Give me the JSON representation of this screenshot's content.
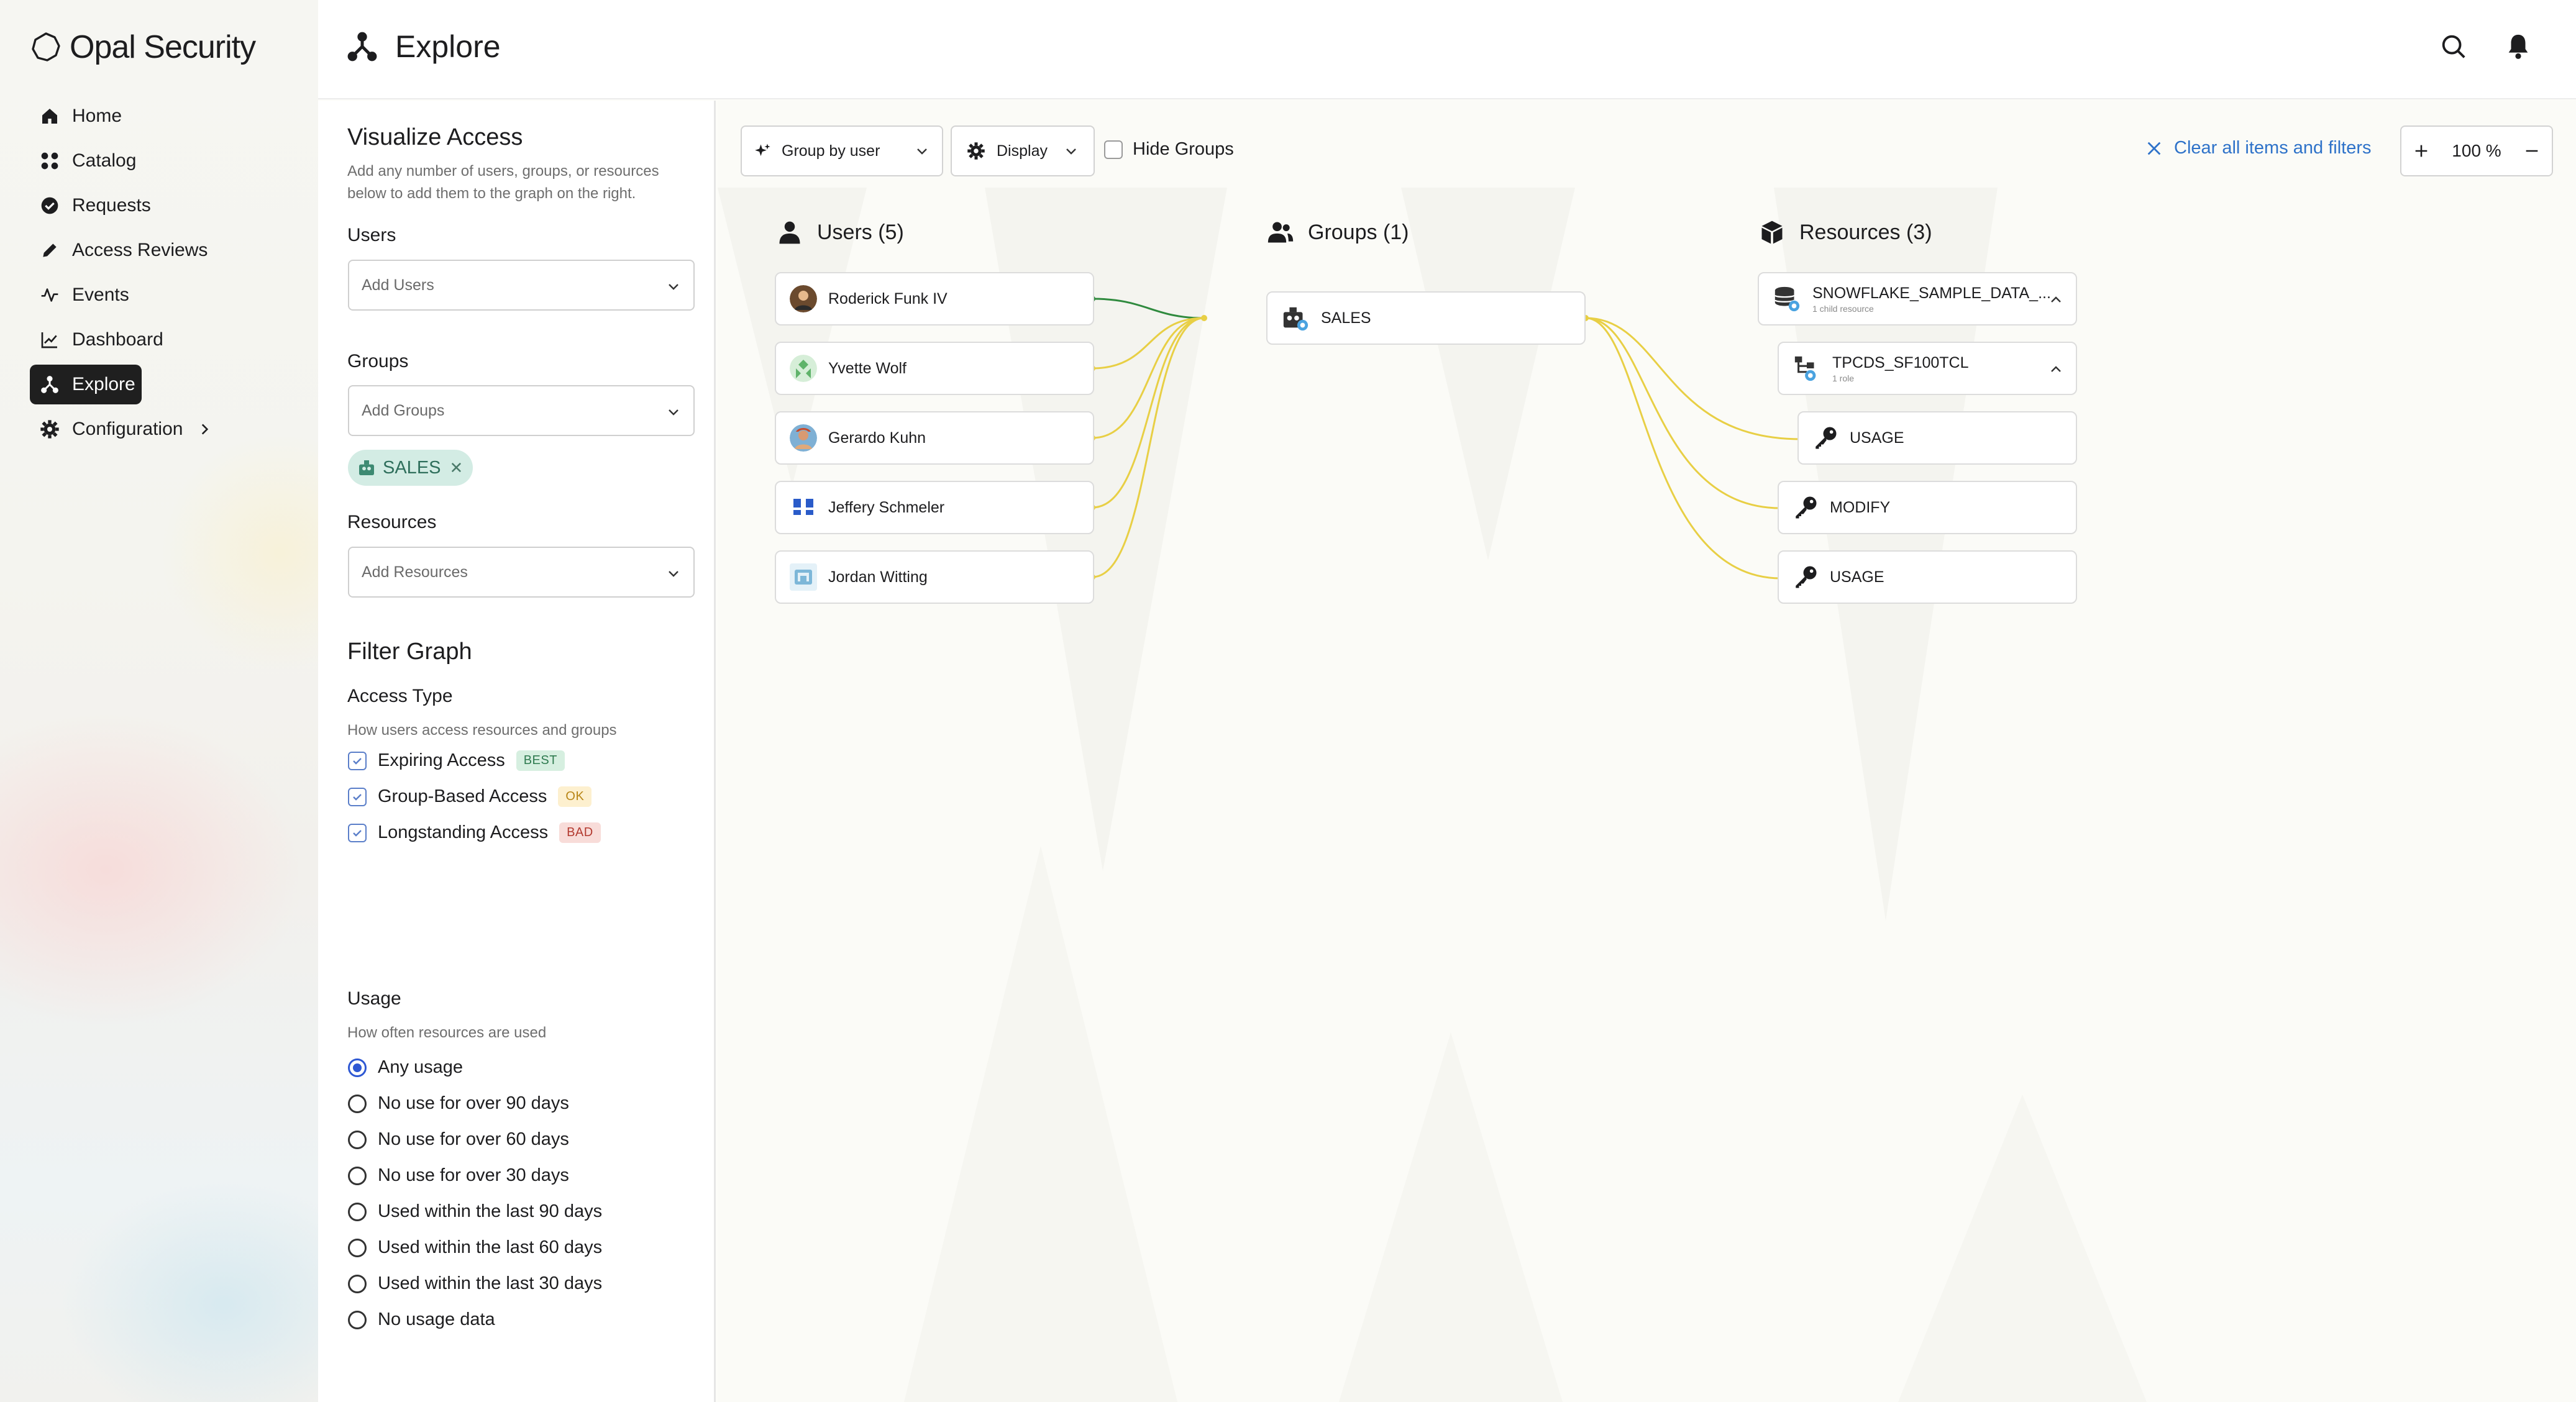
{
  "app": {
    "name": "Opal Security"
  },
  "nav": {
    "items": [
      {
        "label": "Home",
        "icon": "home-icon"
      },
      {
        "label": "Catalog",
        "icon": "grid-icon"
      },
      {
        "label": "Requests",
        "icon": "check-circle-icon"
      },
      {
        "label": "Access Reviews",
        "icon": "pencil-icon"
      },
      {
        "label": "Events",
        "icon": "activity-icon"
      },
      {
        "label": "Dashboard",
        "icon": "line-chart-icon"
      },
      {
        "label": "Explore",
        "icon": "graph-icon",
        "active": true
      },
      {
        "label": "Configuration",
        "icon": "gear-icon"
      }
    ]
  },
  "header": {
    "title": "Explore"
  },
  "panel": {
    "visualize_title": "Visualize Access",
    "visualize_desc_1": "Add any number of users, groups, or resources",
    "visualize_desc_2": "below to add them to the graph on the right.",
    "users_label": "Users",
    "users_placeholder": "Add Users",
    "groups_label": "Groups",
    "groups_placeholder": "Add Groups",
    "selected_group_chip": "SALES",
    "resources_label": "Resources",
    "resources_placeholder": "Add Resources",
    "filter_title": "Filter Graph",
    "access_type_label": "Access Type",
    "access_type_desc": "How users access resources and groups",
    "access_types": [
      {
        "label": "Expiring Access",
        "tag": "BEST",
        "checked": true
      },
      {
        "label": "Group-Based Access",
        "tag": "OK",
        "checked": true
      },
      {
        "label": "Longstanding Access",
        "tag": "BAD",
        "checked": true
      }
    ],
    "usage_label": "Usage",
    "usage_desc": "How often resources are used",
    "usage_options": [
      {
        "label": "Any usage",
        "selected": true
      },
      {
        "label": "No use for over 90 days",
        "selected": false
      },
      {
        "label": "No use for over 60 days",
        "selected": false
      },
      {
        "label": "No use for over 30 days",
        "selected": false
      },
      {
        "label": "Used within the last 90 days",
        "selected": false
      },
      {
        "label": "Used within the last 60 days",
        "selected": false
      },
      {
        "label": "Used within the last 30 days",
        "selected": false
      },
      {
        "label": "No usage data",
        "selected": false
      }
    ]
  },
  "toolbar": {
    "group_by": "Group by user",
    "display": "Display",
    "hide_groups": "Hide Groups",
    "hide_groups_checked": false,
    "clear": "Clear all items and filters",
    "zoom": "100 %"
  },
  "graph": {
    "users_heading": "Users (5)",
    "groups_heading": "Groups (1)",
    "resources_heading": "Resources (3)",
    "users": [
      {
        "name": "Roderick Funk IV"
      },
      {
        "name": "Yvette Wolf"
      },
      {
        "name": "Gerardo Kuhn"
      },
      {
        "name": "Jeffery Schmeler"
      },
      {
        "name": "Jordan Witting"
      }
    ],
    "groups": [
      {
        "name": "SALES"
      }
    ],
    "resources": {
      "root": {
        "name": "SNOWFLAKE_SAMPLE_DATA_...",
        "sub": "1 child resource"
      },
      "child": {
        "name": "TPCDS_SF100TCL",
        "sub": "1 role"
      },
      "roles": [
        {
          "name": "USAGE"
        },
        {
          "name": "MODIFY"
        },
        {
          "name": "USAGE"
        }
      ]
    },
    "colors": {
      "edge_green": "#2f8a3e",
      "edge_yellow": "#e8cf45",
      "accent_blue": "#2e58d3"
    }
  }
}
